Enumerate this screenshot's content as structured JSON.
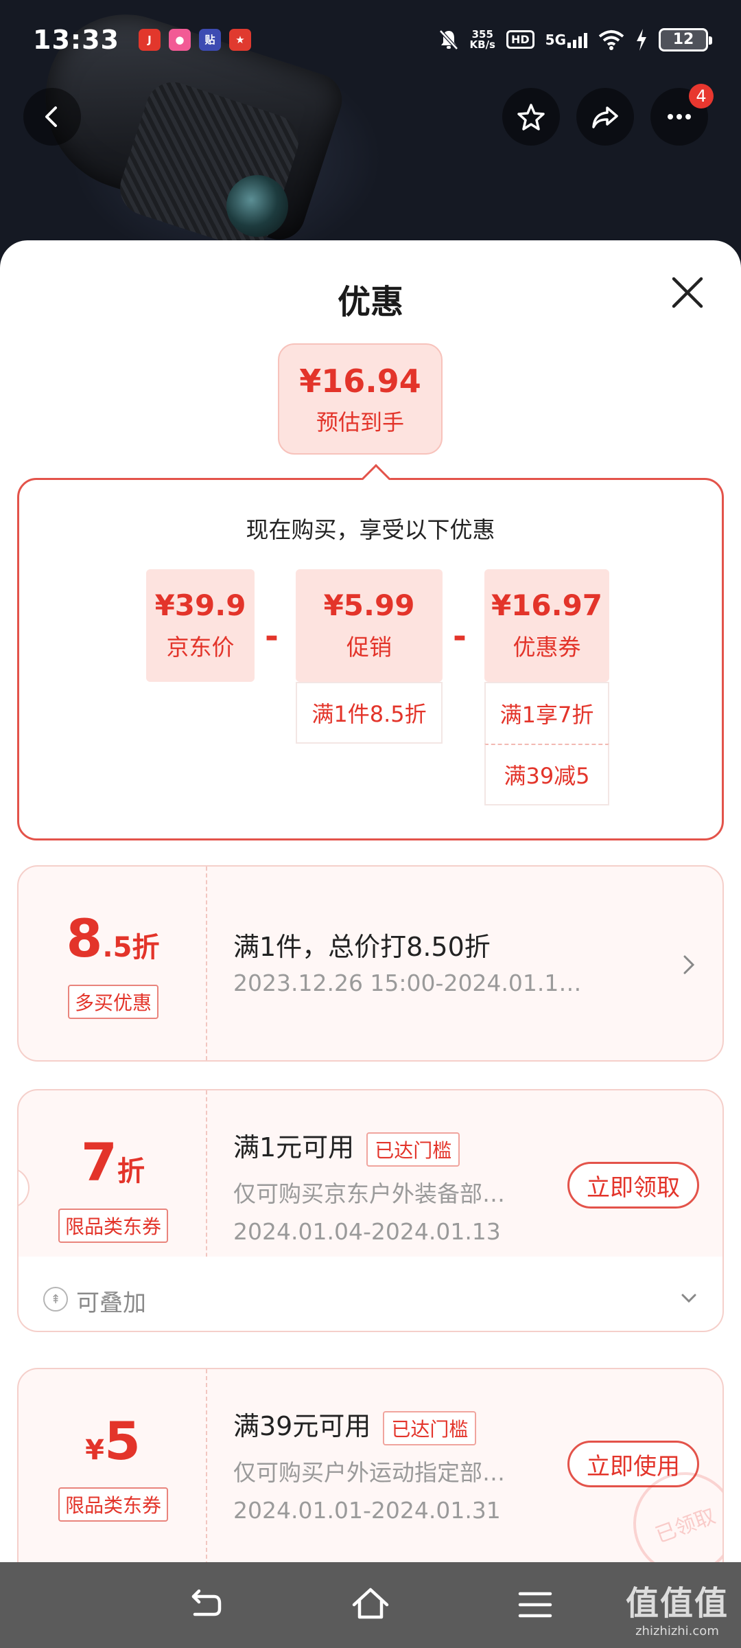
{
  "status_bar": {
    "time": "13:33",
    "apps": [
      {
        "name": "jd-icon",
        "glyph": "J",
        "color": "#e2372c"
      },
      {
        "name": "pink-app-icon",
        "glyph": "●",
        "color": "#f25a95"
      },
      {
        "name": "paste-app-icon",
        "glyph": "贴",
        "color": "#3d4bb2"
      },
      {
        "name": "red-app-icon",
        "glyph": "★",
        "color": "#e03a2f"
      }
    ],
    "net_speed_value": "355",
    "net_speed_unit": "KB/s",
    "hd": "HD",
    "network": "5G",
    "battery": "12"
  },
  "header": {
    "more_badge": "4"
  },
  "sheet": {
    "title": "优惠",
    "estimate_price": "¥16.94",
    "estimate_label": "预估到手",
    "breakdown_heading": "现在购买，享受以下优惠",
    "price_cards": [
      {
        "value": "¥39.9",
        "label": "京东价"
      },
      {
        "value": "¥5.99",
        "label": "促销"
      },
      {
        "value": "¥16.97",
        "label": "优惠券"
      }
    ],
    "minus_sign": "-",
    "promo_tags": [
      "满1件8.5折"
    ],
    "coupon_tags": [
      "满1享7折",
      "满39减5"
    ]
  },
  "coupons": [
    {
      "amount_main": "8",
      "amount_suffix": ".5折",
      "tag": "多买优惠",
      "title": "满1件，总价打8.50折",
      "date": "2023.12.26 15:00-2024.01.1…"
    },
    {
      "amount_main": "7",
      "amount_suffix": "折",
      "tag": "限品类东券",
      "title": "满1元可用",
      "reached": "已达门槛",
      "desc": "仅可购买京东户外装备部…",
      "date": "2024.01.04-2024.01.13",
      "action": "立即领取",
      "stack_label": "可叠加"
    },
    {
      "amount_prefix": "¥",
      "amount_main": "5",
      "tag": "限品类东券",
      "title": "满39元可用",
      "reached": "已达门槛",
      "desc": "仅可购买户外运动指定部…",
      "date": "2024.01.01-2024.01.31",
      "action": "立即使用",
      "stamp": "已领取"
    }
  ],
  "watermark": {
    "brand": "值值值",
    "domain": "zhizhizhi.com"
  },
  "colors": {
    "accent": "#e3342a",
    "soft_pink": "#fde3df"
  }
}
